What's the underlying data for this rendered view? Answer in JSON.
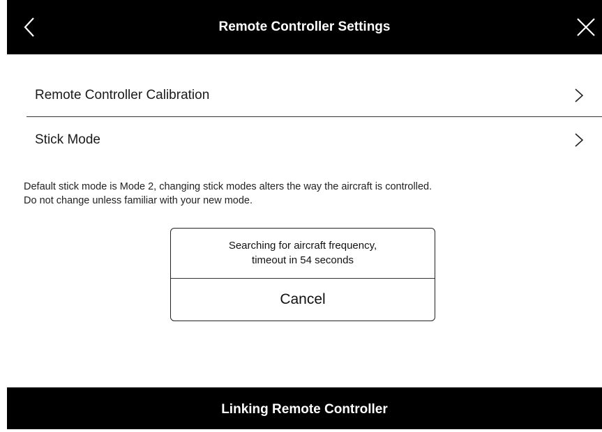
{
  "header": {
    "title": "Remote Controller Settings",
    "back_icon": "chevron-left-icon",
    "close_icon": "close-icon"
  },
  "menu": {
    "items": [
      {
        "label": "Remote Controller Calibration",
        "icon": "chevron-right-icon"
      },
      {
        "label": "Stick Mode",
        "icon": "chevron-right-icon"
      }
    ]
  },
  "note": {
    "line1": "Default stick mode is Mode 2, changing stick modes alters the way the aircraft is controlled.",
    "line2": "Do not change unless familiar with your new mode."
  },
  "dialog": {
    "message_line1": "Searching for aircraft frequency,",
    "message_line2": "timeout in 54 seconds",
    "cancel_label": "Cancel"
  },
  "footer": {
    "status": "Linking Remote Controller"
  },
  "colors": {
    "bar_background": "#000000",
    "bar_text": "#ffffff",
    "page_background": "#ffffff"
  }
}
